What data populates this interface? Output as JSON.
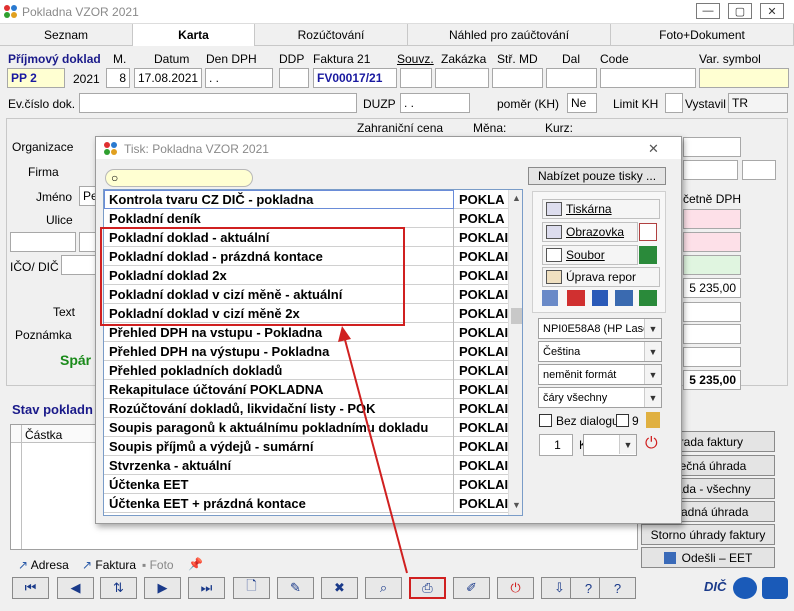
{
  "window": {
    "title": "Pokladna VZOR  2021"
  },
  "tabs": [
    {
      "label": "Seznam"
    },
    {
      "label": "Karta"
    },
    {
      "label": "Rozúčtování"
    },
    {
      "label": "Náhled pro zaúčtování"
    },
    {
      "label": "Foto+Dokument"
    }
  ],
  "header": {
    "doc_label": "Příjmový doklad",
    "m_label": "M.",
    "datum_label": "Datum",
    "den_dph_label": "Den DPH",
    "ddp_label": "DDP",
    "faktura_label": "Faktura  21",
    "souvz_label": "Souvz.",
    "zakazka_label": "Zakázka",
    "str_md_label": "Stř. MD",
    "dal_label": "Dal",
    "code_label": "Code",
    "var_symbol_label": "Var. symbol"
  },
  "values": {
    "pp": "PP   2",
    "year": "2021",
    "month": "8",
    "date": "17.08.2021",
    "den_dph": "  .  .",
    "faktura": "FV00017/21",
    "duzp": "  .  .",
    "pomer": "Ne",
    "vystavil": "TR"
  },
  "labels": {
    "ev_cislo": "Ev.číslo dok.",
    "duzp": "DUZP",
    "pomer": "poměr (KH)",
    "limit_kh": "Limit KH",
    "vystavil": "Vystavil",
    "zahr_cena": "Zahraniční cena",
    "mena": "Měna:",
    "kurz": "Kurz:",
    "organizace": "Organizace",
    "firma": "Firma",
    "jmeno": "Jméno",
    "ulice": "Ulice",
    "ico_dic": "IČO/ DIČ",
    "text": "Text",
    "poznamka": "Poznámka",
    "sparovani": "Spár",
    "stav": "Stav pokladn",
    "castka": "Částka",
    "ucetne_dph": "četně DPH",
    "amount1": "5 235,00",
    "amount2": "5 235,00",
    "jmeno_val": "Pe"
  },
  "right_buttons": [
    "hrada faktury",
    "etečná úhrada",
    "hrada - všechny",
    "hnadná úhrada",
    "Storno úhrady faktury",
    "Odešli – EET"
  ],
  "bottom_links": {
    "adresa": "Adresa",
    "faktura": "Faktura",
    "foto": "Foto"
  },
  "dialog": {
    "title": "Tisk: Pokladna VZOR  2021",
    "search_placeholder": "",
    "offer_button": "Nabízet pouze tisky ...",
    "rows": [
      {
        "name": "Kontrola tvaru CZ DIČ - pokladna",
        "code": "POKLA"
      },
      {
        "name": "Pokladní deník",
        "code": "POKLA"
      },
      {
        "name": "Pokladní doklad - aktuální",
        "code": "POKLAI"
      },
      {
        "name": "Pokladní doklad - prázdná kontace",
        "code": "POKLAI"
      },
      {
        "name": "Pokladní doklad 2x",
        "code": "POKLAI"
      },
      {
        "name": "Pokladní doklad v cizí měně - aktuální",
        "code": "POKLAI"
      },
      {
        "name": "Pokladní doklad v cizí měně 2x",
        "code": "POKLAI"
      },
      {
        "name": "Přehled DPH na vstupu - Pokladna",
        "code": "POKLAI"
      },
      {
        "name": "Přehled DPH na výstupu - Pokladna",
        "code": "POKLAI"
      },
      {
        "name": "Přehled pokladních dokladů",
        "code": "POKLAI"
      },
      {
        "name": "Rekapitulace účtování POKLADNA",
        "code": "POKLAI"
      },
      {
        "name": "Rozúčtování dokladů, likvidační listy - POK",
        "code": "POKLAI"
      },
      {
        "name": "Soupis paragonů k aktuálnímu pokladnímu dokladu",
        "code": "POKLAI"
      },
      {
        "name": "Soupis příjmů a výdejů - sumární",
        "code": "POKLAI"
      },
      {
        "name": "Stvrzenka - aktuální",
        "code": "POKLAI"
      },
      {
        "name": "Účtenka EET",
        "code": "POKLAI"
      },
      {
        "name": "Účtenka EET + prázdná kontace",
        "code": "POKLAI"
      }
    ],
    "tiskarna": "Tiskárna",
    "obrazovka": "Obrazovka",
    "soubor": "Soubor",
    "uprava": "Úprava repor",
    "printer": "NPI0E58A8 (HP Lase",
    "language": "Čeština",
    "format": "neměnit formát",
    "lines": "čáry všechny",
    "bez_dialogu": "Bez dialogu",
    "nine": "9",
    "copies": "1",
    "k": "K"
  }
}
